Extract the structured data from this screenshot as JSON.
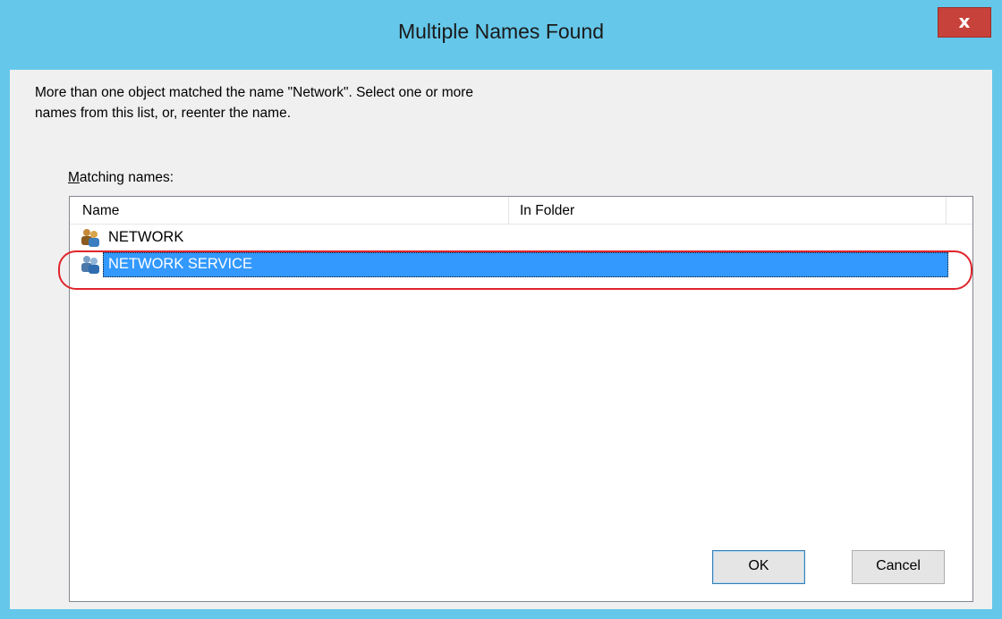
{
  "window": {
    "title": "Multiple Names Found",
    "close_label": "x",
    "accent_color": "#65c7ea"
  },
  "message": {
    "line1": "More than one object matched the name \"Network\". Select one or more",
    "line2": "names from this list, or, reenter the name."
  },
  "matching_label": {
    "accesskey": "M",
    "rest": "atching names:"
  },
  "list": {
    "columns": [
      "Name",
      "In Folder"
    ],
    "rows": [
      {
        "name": "NETWORK",
        "folder": "",
        "icon": "group-icon",
        "selected": false
      },
      {
        "name": "NETWORK SERVICE",
        "folder": "",
        "icon": "group-icon",
        "selected": true
      }
    ],
    "selection_color": "#3399ff"
  },
  "buttons": {
    "ok": "OK",
    "cancel": "Cancel"
  }
}
